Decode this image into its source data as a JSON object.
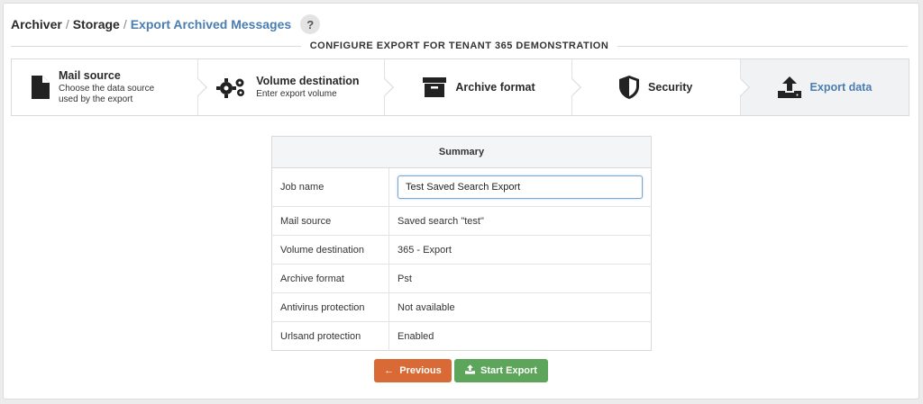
{
  "breadcrumb": {
    "items": [
      "Archiver",
      "Storage",
      "Export Archived Messages"
    ],
    "separator": "/",
    "help_label": "?"
  },
  "section_title": "CONFIGURE EXPORT FOR TENANT 365 DEMONSTRATION",
  "wizard": {
    "steps": [
      {
        "label": "Mail source",
        "description": "Choose the data source used by the export",
        "icon": "file-icon"
      },
      {
        "label": "Volume destination",
        "description": "Enter export volume",
        "icon": "gears-icon"
      },
      {
        "label": "Archive format",
        "description": "",
        "icon": "archive-box-icon"
      },
      {
        "label": "Security",
        "description": "",
        "icon": "shield-icon"
      },
      {
        "label": "Export data",
        "description": "",
        "icon": "upload-icon"
      }
    ],
    "active_step": "Export data"
  },
  "summary": {
    "title": "Summary",
    "job_name_label": "Job name",
    "job_name_value": "Test Saved Search Export",
    "rows": [
      {
        "key": "Mail source",
        "value": "Saved search \"test\""
      },
      {
        "key": "Volume destination",
        "value": "365 - Export"
      },
      {
        "key": "Archive format",
        "value": "Pst"
      },
      {
        "key": "Antivirus protection",
        "value": "Not available"
      },
      {
        "key": "Urlsand protection",
        "value": "Enabled"
      }
    ]
  },
  "buttons": {
    "previous_label": "Previous",
    "start_label": "Start Export"
  },
  "colors": {
    "accent_blue": "#4a7db1",
    "previous_button": "#d96a35",
    "start_button": "#5da55a"
  }
}
